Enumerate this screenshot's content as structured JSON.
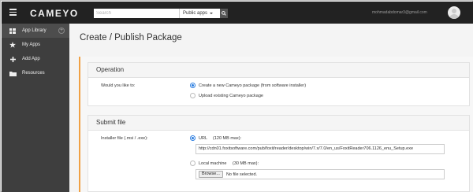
{
  "header": {
    "logo": "CAMEYO",
    "search_placeholder": "Search",
    "search_scope": "Public apps",
    "user_email": "mohmadabdomar3@gmail.com"
  },
  "sidebar": {
    "items": [
      {
        "label": "App Library",
        "icon": "grid-icon"
      },
      {
        "label": "My Apps",
        "icon": "star-icon"
      },
      {
        "label": "Add App",
        "icon": "plus-icon"
      },
      {
        "label": "Resources",
        "icon": "folder-icon"
      }
    ]
  },
  "page": {
    "title": "Create / Publish Package"
  },
  "operation": {
    "heading": "Operation",
    "question": "Would you like to:",
    "options": [
      {
        "label": "Create a new Cameyo package (from software installer)",
        "selected": true
      },
      {
        "label": "Upload existing Cameyo package",
        "selected": false
      }
    ]
  },
  "submit": {
    "heading": "Submit file",
    "installer_label": "Installer file (.msi / .exe):",
    "url_option": "URL",
    "url_limit": "(120 MB max):",
    "url_value": "http://cdn01.foxitsoftware.com/pub/foxit/reader/desktop/win/7.x/7.0/en_us/FoxitReader706.1126_enu_Setup.exe",
    "local_option": "Local machine",
    "local_limit": "(30 MB max):",
    "browse_label": "Browse...",
    "no_file_text": "No file selected."
  },
  "colors": {
    "topbar": "#222222",
    "sidebar": "#3e3e3e",
    "accent": "#f0a044",
    "radio": "#2b7de0"
  }
}
